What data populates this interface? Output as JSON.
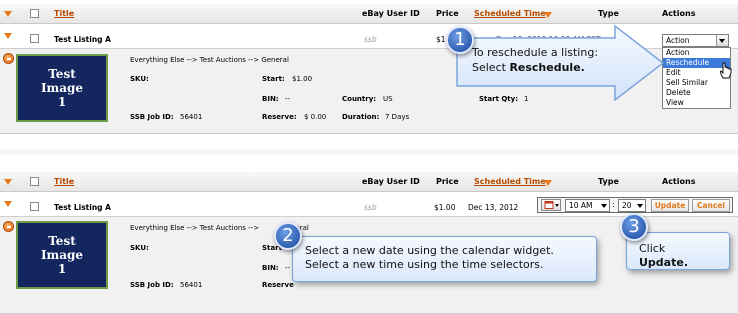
{
  "columns": {
    "title": "Title",
    "user_id": "eBay User ID",
    "price": "Price",
    "scheduled_time": "Scheduled Time",
    "type": "Type",
    "actions": "Actions"
  },
  "listing": {
    "title": "Test Listing A",
    "user_id": "ssb",
    "price_partial": "$1.",
    "price": "$1.00",
    "date_partial": "Dec 13, 2012 10:30 AM PST",
    "date": "Dec 13, 2012",
    "category": "Everything Else --> Test Auctions --> General",
    "category_partial": "Everything Else --> Test Auctions -->",
    "category_tail": "neral",
    "sku_label": "SKU:",
    "start_label": "Start:",
    "start_value": "$1.00",
    "start_label_partial": "Start",
    "bin_label": "BIN:",
    "bin_value": "--",
    "country_label": "Country:",
    "country_value": "US",
    "start_qty_label": "Start Qty:",
    "start_qty_value": "1",
    "job_label": "SSB Job ID:",
    "job_value": "56401",
    "reserve_label": "Reserve:",
    "reserve_value": "$ 0.00",
    "reserve_label_partial": "Reserve",
    "duration_label": "Duration:",
    "duration_value": "7 Days",
    "image_line1": "Test",
    "image_line2": "Image",
    "image_line3": "1"
  },
  "actions_dropdown": {
    "current": "Action",
    "options": [
      "Action",
      "Reschedule",
      "Edit",
      "Sell Similar",
      "Delete",
      "View"
    ],
    "selected_index": 1
  },
  "reschedule_controls": {
    "hour": "10 AM",
    "minute": "20",
    "update_label": "Update",
    "cancel_label": "Cancel"
  },
  "callouts": {
    "step1_number": "1",
    "step1_text": "To reschedule a listing:",
    "step1_prefix": "Select ",
    "step1_bold": "Reschedule.",
    "step2_number": "2",
    "step2_line1": "Select a new date using the calendar widget.",
    "step2_line2": "Select a new time using the time selectors.",
    "step3_number": "3",
    "step3_prefix": "Click ",
    "step3_bold": "Update."
  },
  "colors": {
    "accent": "#e07c1d",
    "callout_blue": "#3a6fc4",
    "thumb_bg": "#13275e"
  }
}
